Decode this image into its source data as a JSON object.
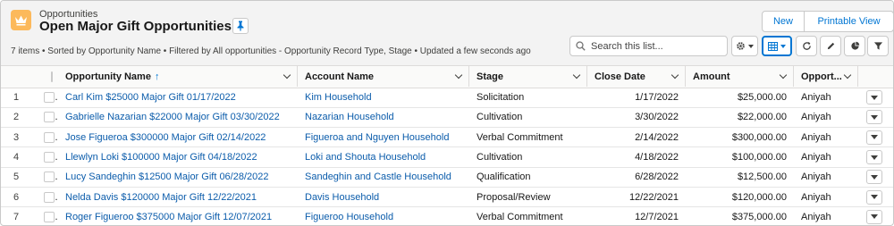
{
  "header": {
    "object_label": "Opportunities",
    "list_title": "Open Major Gift Opportunities",
    "meta": "7 items • Sorted by Opportunity Name • Filtered by All opportunities - Opportunity Record Type, Stage • Updated a few seconds ago",
    "new_label": "New",
    "printable_label": "Printable View",
    "search_placeholder": "Search this list...",
    "accent_color": "#fcb95b"
  },
  "table": {
    "columns": [
      "Opportunity Name",
      "Account Name",
      "Stage",
      "Close Date",
      "Amount",
      "Opport..."
    ],
    "sort_indicator": "↑",
    "rows": [
      {
        "num": "1",
        "opportunity": "Carl Kim $25000 Major Gift 01/17/2022",
        "account": "Kim Household",
        "stage": "Solicitation",
        "close_date": "1/17/2022",
        "amount": "$25,000.00",
        "owner": "Aniyah"
      },
      {
        "num": "2",
        "opportunity": "Gabrielle Nazarian $22000 Major Gift 03/30/2022",
        "account": "Nazarian Household",
        "stage": "Cultivation",
        "close_date": "3/30/2022",
        "amount": "$22,000.00",
        "owner": "Aniyah"
      },
      {
        "num": "3",
        "opportunity": "Jose Figueroa $300000 Major Gift 02/14/2022",
        "account": "Figueroa and Nguyen Household",
        "stage": "Verbal Commitment",
        "close_date": "2/14/2022",
        "amount": "$300,000.00",
        "owner": "Aniyah"
      },
      {
        "num": "4",
        "opportunity": "Llewlyn Loki $100000 Major Gift 04/18/2022",
        "account": "Loki and Shouta Household",
        "stage": "Cultivation",
        "close_date": "4/18/2022",
        "amount": "$100,000.00",
        "owner": "Aniyah"
      },
      {
        "num": "5",
        "opportunity": "Lucy Sandeghin $12500 Major Gift 06/28/2022",
        "account": "Sandeghin and Castle Household",
        "stage": "Qualification",
        "close_date": "6/28/2022",
        "amount": "$12,500.00",
        "owner": "Aniyah"
      },
      {
        "num": "6",
        "opportunity": "Nelda Davis $120000 Major Gift 12/22/2021",
        "account": "Davis Household",
        "stage": "Proposal/Review",
        "close_date": "12/22/2021",
        "amount": "$120,000.00",
        "owner": "Aniyah"
      },
      {
        "num": "7",
        "opportunity": "Roger Figueroo $375000 Major Gift 12/07/2021",
        "account": "Figueroo Household",
        "stage": "Verbal Commitment",
        "close_date": "12/7/2021",
        "amount": "$375,000.00",
        "owner": "Aniyah"
      }
    ]
  }
}
